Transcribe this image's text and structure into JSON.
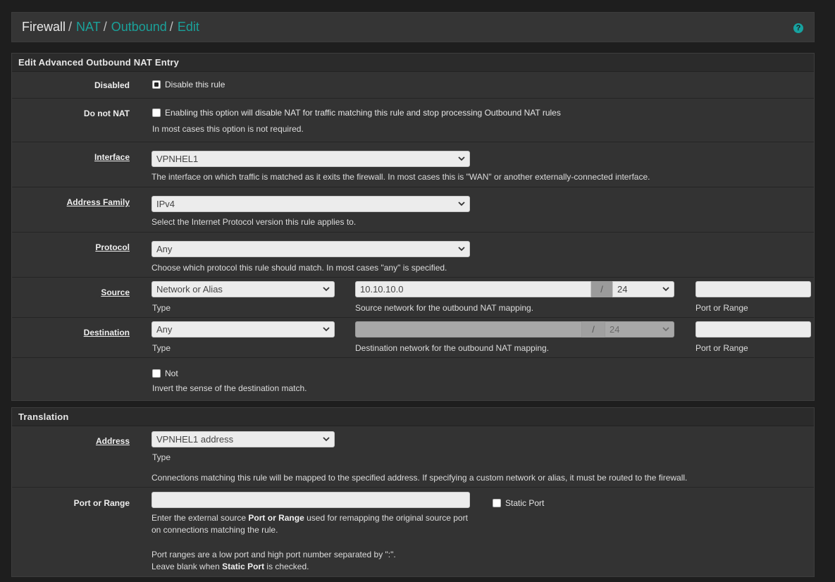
{
  "breadcrumb": {
    "items": [
      "Firewall",
      "NAT",
      "Outbound",
      "Edit"
    ],
    "help_icon": "?"
  },
  "panel1": {
    "title": "Edit Advanced Outbound NAT Entry",
    "disabled": {
      "label": "Disabled",
      "checkbox_text": "Disable this rule",
      "checked": true
    },
    "do_not_nat": {
      "label": "Do not NAT",
      "checkbox_text": "Enabling this option will disable NAT for traffic matching this rule and stop processing Outbound NAT rules",
      "help": "In most cases this option is not required.",
      "checked": false
    },
    "interface": {
      "label": "Interface",
      "value": "VPNHEL1",
      "help": "The interface on which traffic is matched as it exits the firewall. In most cases this is \"WAN\" or another externally-connected interface."
    },
    "address_family": {
      "label": "Address Family",
      "value": "IPv4",
      "help": "Select the Internet Protocol version this rule applies to."
    },
    "protocol": {
      "label": "Protocol",
      "value": "Any",
      "help": "Choose which protocol this rule should match. In most cases \"any\" is specified."
    },
    "source": {
      "label": "Source",
      "type_value": "Network or Alias",
      "type_help": "Type",
      "network": "10.10.10.0",
      "slash": "/",
      "mask": "24",
      "network_help": "Source network for the outbound NAT mapping.",
      "port": "",
      "port_help": "Port or Range"
    },
    "destination": {
      "label": "Destination",
      "type_value": "Any",
      "type_help": "Type",
      "network": "",
      "slash": "/",
      "mask": "24",
      "network_help": "Destination network for the outbound NAT mapping.",
      "port": "",
      "port_help": "Port or Range"
    },
    "not": {
      "checkbox_text": "Not",
      "help": "Invert the sense of the destination match.",
      "checked": false
    }
  },
  "panel2": {
    "title": "Translation",
    "address": {
      "label": "Address",
      "value": "VPNHEL1 address",
      "type_help": "Type",
      "help": "Connections matching this rule will be mapped to the specified address. If specifying a custom network or alias, it must be routed to the firewall."
    },
    "port_range": {
      "label": "Port or Range",
      "value": "",
      "static_port_text": "Static Port",
      "static_checked": false,
      "help1_pre": "Enter the external source ",
      "help1_bold": "Port or Range",
      "help1_post": " used for remapping the original source port",
      "help2": "on connections matching the rule.",
      "help3": "Port ranges are a low port and high port number separated by \":\".",
      "help4_pre": "Leave blank when ",
      "help4_bold": "Static Port",
      "help4_post": " is checked."
    }
  },
  "colors": {
    "accent": "#1aa19a",
    "panel_bg": "#333333",
    "heading_bg": "#2b2b2b",
    "page_bg": "#1e1e1e"
  }
}
